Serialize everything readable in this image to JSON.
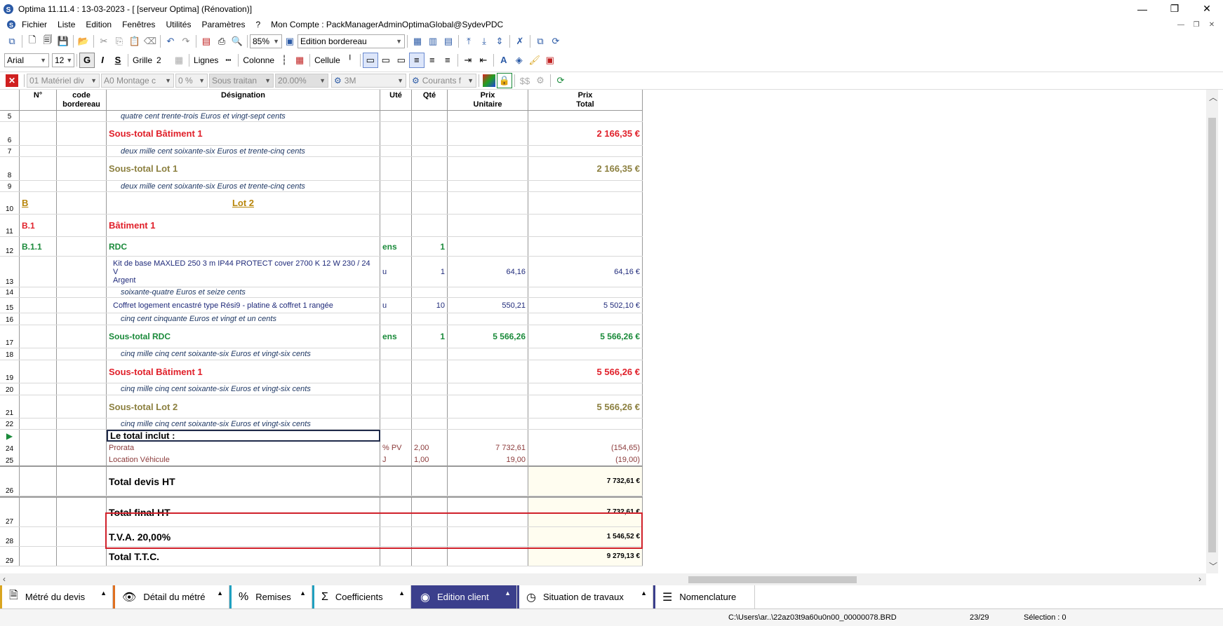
{
  "window": {
    "title": "Optima 11.11.4 : 13-03-2023 - [ [serveur Optima] (Rénovation)]",
    "minimize": "—",
    "restore": "❐",
    "close": "✕"
  },
  "menu": {
    "items": [
      "Fichier",
      "Liste",
      "Edition",
      "Fenêtres",
      "Utilités",
      "Paramètres",
      "?",
      "Mon Compte : PackManagerAdminOptimaGlobal@SydevPDC"
    ]
  },
  "toolbar1": {
    "zoom": "85%",
    "view": "Edition bordereau"
  },
  "toolbar2": {
    "font": "Arial",
    "size": "12",
    "bold": "G",
    "italic": "I",
    "strike": "S",
    "grille_label": "Grille",
    "grille_value": "2",
    "lignes_label": "Lignes",
    "colonne_label": "Colonne",
    "cellule_label": "Cellule"
  },
  "toolbar3": {
    "materiel": "01  Matériel div",
    "montage": "A0  Montage c",
    "pct": "0 %",
    "sous_traitan": "Sous traitan",
    "rate": "20.00%",
    "value_3m": "3M",
    "courants": "Courants f"
  },
  "header": {
    "num": "N°",
    "code": "code\nbordereau",
    "designation": "Désignation",
    "ute": "Uté",
    "qte": "Qté",
    "pu": "Prix\nUnitaire",
    "pt": "Prix\nTotal"
  },
  "rows": [
    {
      "n": "5",
      "des": "quatre cent trente-trois Euros et vingt-sept cents"
    },
    {
      "n": "6",
      "des": "Sous-total Bâtiment 1",
      "pt": "2 166,35 €"
    },
    {
      "n": "7",
      "des": "deux mille cent soixante-six Euros et trente-cinq cents"
    },
    {
      "n": "8",
      "des": "Sous-total Lot 1",
      "pt": "2 166,35 €"
    },
    {
      "n": "9",
      "des": "deux mille cent soixante-six Euros et trente-cinq cents"
    },
    {
      "n": "10",
      "num": "B",
      "des": "Lot 2"
    },
    {
      "n": "11",
      "num": "B.1",
      "des": "Bâtiment 1"
    },
    {
      "n": "12",
      "num": "B.1.1",
      "des": "RDC",
      "ute": "ens",
      "qte": "1"
    },
    {
      "n": "13",
      "des": "Kit de base MAXLED 250 3 m IP44 PROTECT cover 2700 K 12 W 230 / 24 V",
      "des2": "Argent",
      "ute": "u",
      "qte": "1",
      "pu": "64,16",
      "pt": "64,16 €"
    },
    {
      "n": "14",
      "des": "soixante-quatre Euros et seize cents"
    },
    {
      "n": "15",
      "des": "Coffret logement encastré type Rési9 - platine & coffret 1 rangée",
      "ute": "u",
      "qte": "10",
      "pu": "550,21",
      "pt": "5 502,10 €"
    },
    {
      "n": "16",
      "des": "cinq cent cinquante Euros et vingt et un cents"
    },
    {
      "n": "17",
      "des": "Sous-total RDC",
      "ute": "ens",
      "qte": "1",
      "pu": "5 566,26",
      "pt": "5 566,26 €"
    },
    {
      "n": "18",
      "des": "cinq mille cinq cent soixante-six Euros et vingt-six cents"
    },
    {
      "n": "19",
      "des": "Sous-total Bâtiment 1",
      "pt": "5 566,26 €"
    },
    {
      "n": "20",
      "des": "cinq mille cinq cent soixante-six Euros et vingt-six cents"
    },
    {
      "n": "21",
      "des": "Sous-total Lot 2",
      "pt": "5 566,26 €"
    },
    {
      "n": "22",
      "des": "cinq mille cinq cent soixante-six Euros et vingt-six cents"
    },
    {
      "n": "",
      "des": "Le total inclut :"
    },
    {
      "n": "24",
      "des": "Prorata",
      "ute": "% PV",
      "qte": "2,00",
      "pu": "7 732,61",
      "pt": "(154,65)"
    },
    {
      "n": "25",
      "des": "Location Véhicule",
      "ute": "J",
      "qte": "1,00",
      "pu": "19,00",
      "pt": "(19,00)"
    },
    {
      "n": "26",
      "des": "Total devis HT",
      "pt": "7 732,61 €"
    },
    {
      "n": "27",
      "des": "Total final HT",
      "pt": "7 732,61 €"
    },
    {
      "n": "28",
      "des": "T.V.A. 20,00%",
      "pt": "1 546,52 €"
    },
    {
      "n": "29",
      "des": "Total  T.T.C.",
      "pt": "9 279,13 €"
    }
  ],
  "tabs": [
    {
      "label": "Métré du devis"
    },
    {
      "label": "Détail du métré"
    },
    {
      "label": "Remises"
    },
    {
      "label": "Coefficients"
    },
    {
      "label": "Edition client"
    },
    {
      "label": "Situation de travaux"
    },
    {
      "label": "Nomenclature"
    }
  ],
  "status": {
    "path": "C:\\Users\\ar..\\22az03t9a60u0n00_00000078.BRD",
    "position": "23/29",
    "selection": "Sélection : 0"
  },
  "colors": {
    "red": "#e0202a",
    "olive": "#8c8040",
    "green": "#1a8a3a",
    "navy": "#1f2a7a",
    "tab_active": "#3b3f8c"
  }
}
